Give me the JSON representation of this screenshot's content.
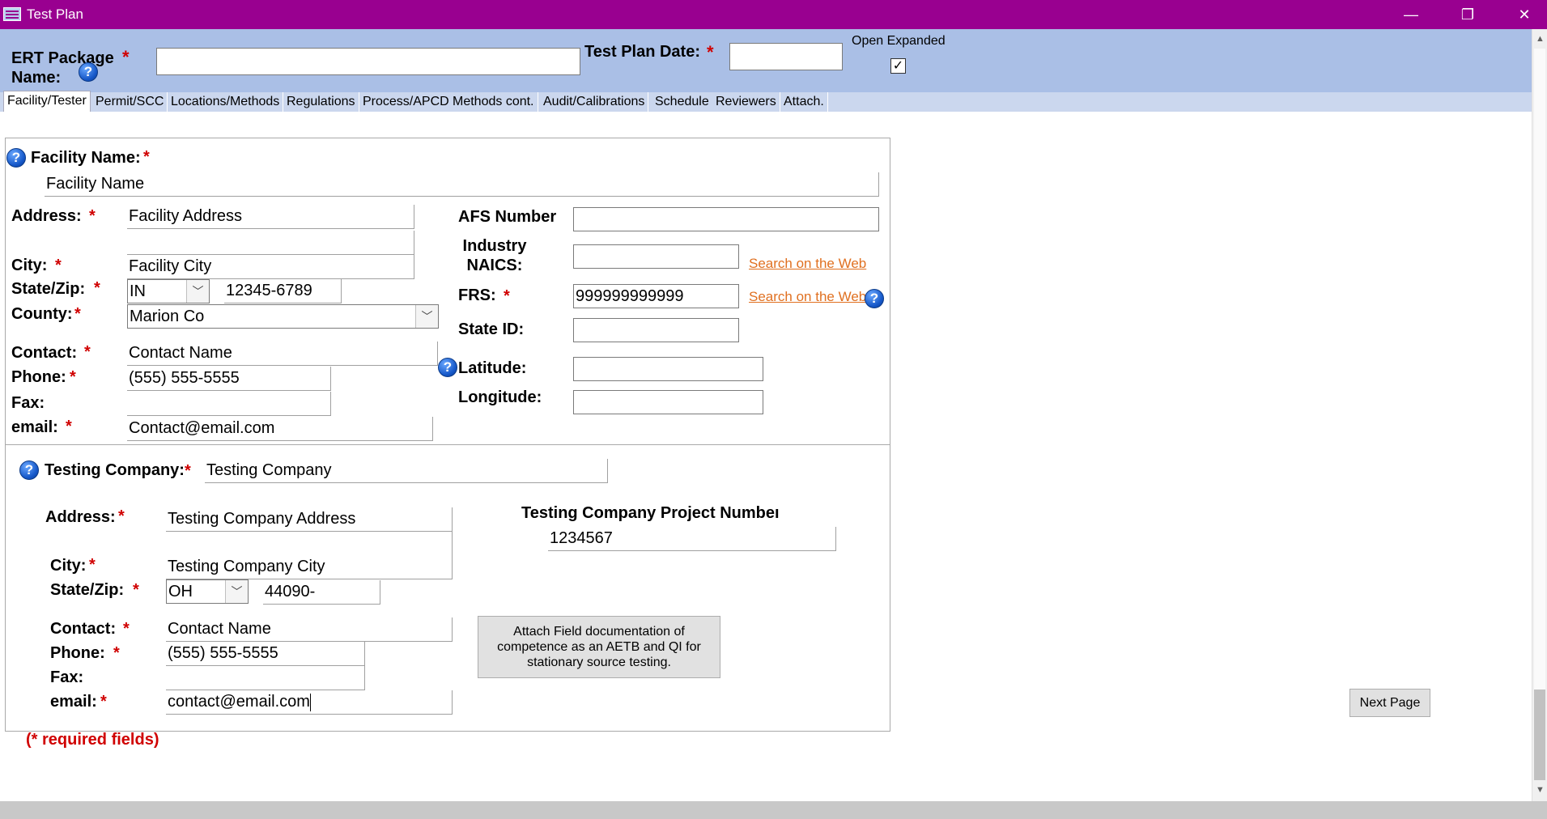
{
  "window": {
    "title": "Test Plan",
    "minimize_glyph": "—",
    "restore_glyph": "❐",
    "close_glyph": "✕"
  },
  "header": {
    "ert_package_label": "ERT Package Name:",
    "ert_package_value": "",
    "test_plan_date_label": "Test Plan Date:",
    "test_plan_date_value": "",
    "open_expanded_label": "Open Expanded",
    "open_expanded_checked": true,
    "required_mark": "*",
    "help_glyph": "?"
  },
  "tabs": [
    {
      "label": "Facility/Tester",
      "active": true
    },
    {
      "label": "Permit/SCC"
    },
    {
      "label": "Locations/Methods"
    },
    {
      "label": "Regulations"
    },
    {
      "label": "Process/APCD"
    },
    {
      "label": "Methods cont."
    },
    {
      "label": "Audit/Calibrations"
    },
    {
      "label": "Schedule"
    },
    {
      "label": "Reviewers"
    },
    {
      "label": "Attach."
    }
  ],
  "facility": {
    "name_label": "Facility Name:",
    "name_value": "Facility Name",
    "address_label": "Address:",
    "address_line1": "Facility Address",
    "address_line2": "",
    "city_label": "City:",
    "city_value": "Facility City",
    "state_zip_label": "State/Zip:",
    "state_value": "IN",
    "zip_value": "12345-6789",
    "county_label": "County:",
    "county_value": "Marion Co",
    "contact_label": "Contact:",
    "contact_value": "Contact Name",
    "phone_label": "Phone:",
    "phone_value": "(555) 555-5555",
    "fax_label": "Fax:",
    "fax_value": "",
    "email_label": "email:",
    "email_value": "Contact@email.com",
    "afs_label": "AFS Number",
    "afs_value": "",
    "naics_label_line1": "Industry",
    "naics_label_line2": "NAICS:",
    "naics_value": "",
    "naics_search_link": "Search on the Web",
    "frs_label": "FRS:",
    "frs_value": "999999999999",
    "frs_search_link": "Search on the Web",
    "state_id_label": "State ID:",
    "state_id_value": "",
    "latitude_label": "Latitude:",
    "latitude_value": "",
    "longitude_label": "Longitude:",
    "longitude_value": ""
  },
  "testing_company": {
    "name_label": "Testing Company:",
    "name_value": "Testing Company",
    "address_label": "Address:",
    "address_line1": "Testing Company Address",
    "address_line2": "",
    "city_label": "City:",
    "city_value": "Testing Company City",
    "state_zip_label": "State/Zip:",
    "state_value": "OH",
    "zip_value": "44090-",
    "contact_label": "Contact:",
    "contact_value": "Contact Name",
    "phone_label": "Phone:",
    "phone_value": "(555) 555-5555",
    "fax_label": "Fax:",
    "fax_value": "",
    "email_label": "email:",
    "email_value": "contact@email.com",
    "project_number_label": "Testing Company Project Numbeı",
    "project_number_value": "1234567",
    "attach_button_label": "Attach Field documentation of competence as an AETB and QI for stationary source testing."
  },
  "footer": {
    "required_note": "(* required fields)",
    "next_page_label": "Next Page"
  },
  "colors": {
    "titlebar": "#990090",
    "header_bg": "#aabfe6",
    "required": "#d00000",
    "link": "#e07020"
  }
}
